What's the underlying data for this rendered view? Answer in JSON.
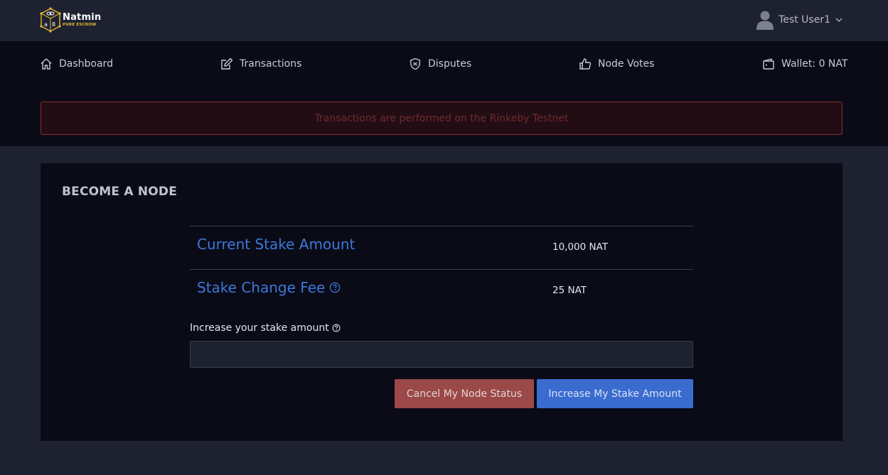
{
  "header": {
    "logo": {
      "name": "Natmin",
      "tagline": "PURE ESCROW",
      "icon": "natmin-logo-icon"
    },
    "user": {
      "name": "Test User1",
      "avatar_icon": "user-avatar-icon",
      "chevron_icon": "chevron-down-icon"
    }
  },
  "nav": {
    "items": [
      {
        "label": "Dashboard",
        "icon": "home-icon"
      },
      {
        "label": "Transactions",
        "icon": "edit-icon"
      },
      {
        "label": "Disputes",
        "icon": "shield-icon"
      },
      {
        "label": "Node Votes",
        "icon": "thumbs-up-icon"
      },
      {
        "label": "Wallet: 0 NAT",
        "icon": "wallet-icon"
      }
    ]
  },
  "notice": {
    "text": "Transactions are performed on the Rinkeby Testnet"
  },
  "card": {
    "title": "BECOME A NODE",
    "rows": [
      {
        "label": "Current Stake Amount",
        "value": "10,000 NAT"
      },
      {
        "label": "Stake Change Fee",
        "value": "25 NAT",
        "help_icon": "question-circle-icon"
      }
    ],
    "increase": {
      "label": "Increase your stake amount",
      "help_icon": "question-circle-icon",
      "value": "",
      "placeholder": ""
    },
    "buttons": {
      "cancel": "Cancel My Node Status",
      "increase": "Increase My Stake Amount"
    }
  },
  "colors": {
    "background": "#1e2130",
    "panel": "#0a0b17",
    "accent_blue": "#3d78d8",
    "danger": "#9a4848",
    "primary": "#3a6cd0",
    "logo_gold": "#e8b830"
  }
}
